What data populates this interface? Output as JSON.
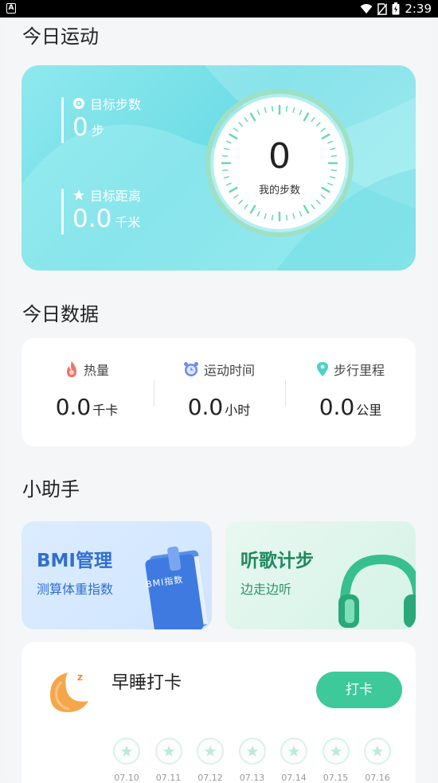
{
  "status_bar": {
    "app_badge": "A",
    "time": "2:39"
  },
  "today_sport": {
    "title": "今日运动",
    "target_steps": {
      "label": "目标步数",
      "value": "0",
      "unit": "步"
    },
    "target_distance": {
      "label": "目标距离",
      "value": "0.0",
      "unit": "千米"
    },
    "my_steps": {
      "value": "0",
      "label": "我的步数"
    }
  },
  "today_data": {
    "title": "今日数据",
    "calories": {
      "label": "热量",
      "value": "0.0",
      "unit": "千卡"
    },
    "exercise_time": {
      "label": "运动时间",
      "value": "0.0",
      "unit": "小时"
    },
    "walk_distance": {
      "label": "步行里程",
      "value": "0.0",
      "unit": "公里"
    }
  },
  "assistant": {
    "title": "小助手",
    "bmi": {
      "title": "BMI管理",
      "subtitle": "测算体重指数",
      "book_label": "BMI指数"
    },
    "music": {
      "title": "听歌计步",
      "subtitle": "边走边听"
    }
  },
  "sleep": {
    "title": "早睡打卡",
    "button": "打卡",
    "days": [
      "07.10",
      "07.11",
      "07.12",
      "07.13",
      "07.14",
      "07.15",
      "07.16"
    ]
  },
  "colors": {
    "accent": "#3dc99a",
    "sport_card": "#7fe3ea",
    "bmi_blue": "#2f6fd1",
    "music_green": "#1e8a5e"
  }
}
